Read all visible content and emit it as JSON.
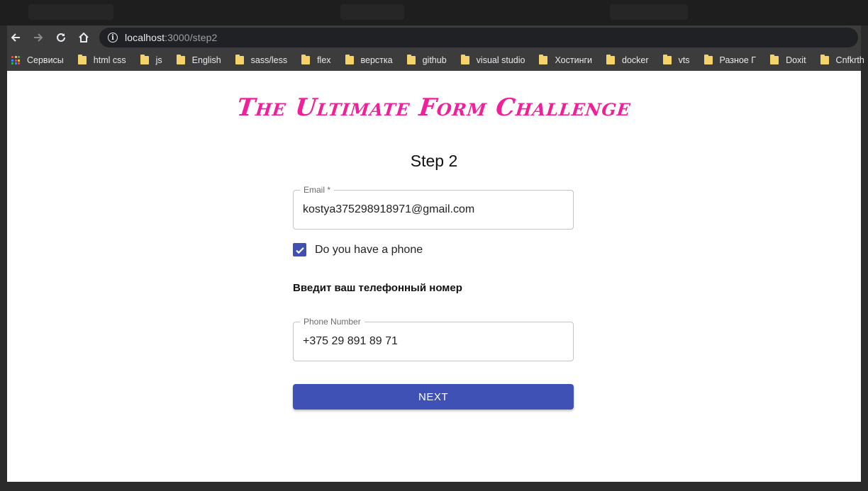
{
  "browser": {
    "url_host": "localhost",
    "url_path": ":3000/step2",
    "bookmarks": [
      {
        "label": "Сервисы",
        "icon": "apps-grid-icon"
      },
      {
        "label": "html css",
        "icon": "folder-icon"
      },
      {
        "label": "js",
        "icon": "folder-icon"
      },
      {
        "label": "English",
        "icon": "folder-icon"
      },
      {
        "label": "sass/less",
        "icon": "folder-icon"
      },
      {
        "label": "flex",
        "icon": "folder-icon"
      },
      {
        "label": "верстка",
        "icon": "folder-icon"
      },
      {
        "label": "github",
        "icon": "folder-icon"
      },
      {
        "label": "visual studio",
        "icon": "folder-icon"
      },
      {
        "label": "Хостинги",
        "icon": "folder-icon"
      },
      {
        "label": "docker",
        "icon": "folder-icon"
      },
      {
        "label": "vts",
        "icon": "folder-icon"
      },
      {
        "label": "Разное Г",
        "icon": "folder-icon"
      },
      {
        "label": "Doxit",
        "icon": "folder-icon"
      },
      {
        "label": "Cnfkrth",
        "icon": "folder-icon"
      }
    ]
  },
  "page": {
    "title": "The Ultimate Form Challenge",
    "step_title": "Step 2",
    "email": {
      "label": "Email *",
      "value": "kostya375298918971@gmail.com"
    },
    "phone_checkbox": {
      "label": "Do you have a phone",
      "checked": true
    },
    "phone_hint": "Введит ваш телефонный номер",
    "phone": {
      "label": "Phone Number",
      "value": "+375 29 891 89 71"
    },
    "next_label": "NEXT"
  },
  "colors": {
    "title": "#f0209a",
    "primary": "#3f51b5",
    "folder": "#f4d36b"
  }
}
